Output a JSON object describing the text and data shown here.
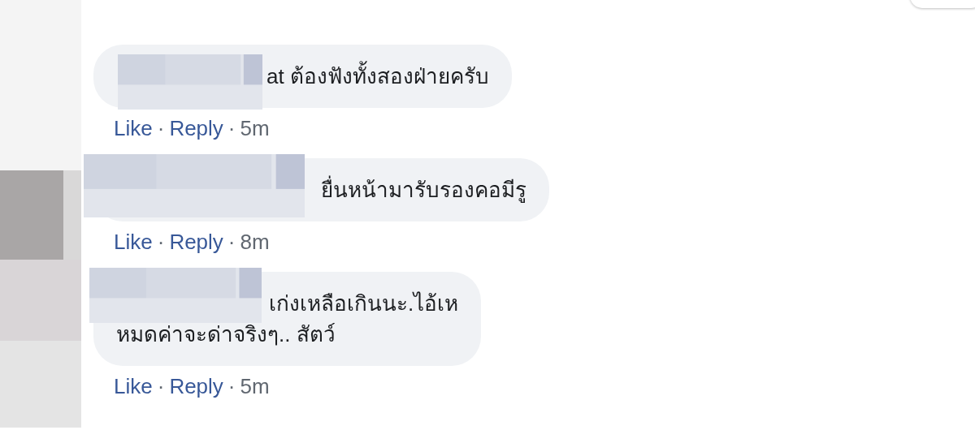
{
  "comments": [
    {
      "lines": [
        "at ต้องฟังทั้งสองฝ่ายครับ"
      ],
      "like": "Like",
      "separator": "·",
      "reply": "Reply",
      "time": "5m"
    },
    {
      "lines": [
        "ยื่นหน้ามารับรองคอมีรู"
      ],
      "like": "Like",
      "separator": "·",
      "reply": "Reply",
      "time": "8m"
    },
    {
      "lines": [
        "เก่งเหลือเกินนะ.ไอ้เห",
        "หมดค่าจะด่าจริงๆ.. สัตว์"
      ],
      "like": "Like",
      "separator": "·",
      "reply": "Reply",
      "time": "5m"
    }
  ]
}
